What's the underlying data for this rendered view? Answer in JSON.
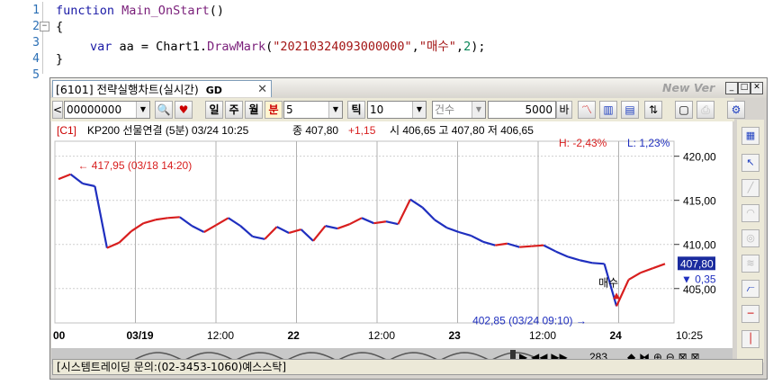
{
  "editor": {
    "line_numbers": [
      "1",
      "2",
      "3",
      "4",
      "5"
    ],
    "lines": {
      "l1_kw": "function",
      "l1_fn": "Main_OnStart",
      "l1_rest": "()",
      "l2": "{",
      "l3_kw": "var",
      "l3_a": " aa = Chart1.",
      "l3_fn": "DrawMark",
      "l3_p1": "(",
      "l3_s1": "\"20210324093000000\"",
      "l3_c": ",",
      "l3_s2": "\"매수\"",
      "l3_c2": ",",
      "l3_n": "2",
      "l3_end": ");",
      "l4": "}"
    }
  },
  "window": {
    "tab_title": "[6101] 전략실행차트(실시간)",
    "tab_link_icon": "link-icon",
    "new_ver": "New Ver",
    "toolbar": {
      "code": "00000000",
      "period_labels": [
        "일",
        "주",
        "월",
        "분"
      ],
      "minute_value": "5",
      "tick_label": "틱",
      "tick_value": "10",
      "count_label": "건수",
      "count_value": "5000",
      "unit": "바"
    },
    "status_text": "[시스템트레이딩 문의:(02-3453-1060)예스스탁]",
    "scroll_count": "283"
  },
  "chart_data": {
    "type": "line",
    "title": "[C1]  KP200 선물연결 (5분) 03/24 10:25   종 407,80 +1,15   시 406,65 고 407,80 저 406,65",
    "header": {
      "code": "[C1]",
      "name": "KP200 선물연결 (5분) 03/24 10:25",
      "close_label": "종 407,80",
      "change": "+1,15",
      "ohlc": "시 406,65 고 407,80 저 406,65"
    },
    "high_label": "H: -2,43%",
    "low_label": "L: 1,23%",
    "yticks": [
      "420,00",
      "415,00",
      "410,00",
      "405,00"
    ],
    "ytick_values": [
      420,
      415,
      410,
      405
    ],
    "ylim": [
      401.1,
      421.7
    ],
    "xticks": [
      "00",
      "03/19",
      "12:00",
      "22",
      "12:00",
      "23",
      "12:00",
      "24",
      "10:25"
    ],
    "xtick_positions": [
      0,
      1,
      2,
      3,
      4,
      5,
      6,
      7,
      8
    ],
    "annotation_max": "417,95 (03/18 14:20)",
    "annotation_min": "402,85 (03/24 09:10)",
    "mark_label": "매수",
    "current_price": "407,80",
    "current_change": "0,35",
    "series": [
      {
        "values": [
          417.4,
          417.95,
          416.9,
          416.6,
          409.6,
          410.2,
          411.5,
          412.4,
          412.8,
          413.0,
          413.1,
          412.1,
          411.4,
          412.2,
          413.0,
          412.1,
          410.9,
          410.6,
          412.0,
          411.3,
          411.7,
          410.4,
          412.1,
          411.8,
          412.3,
          413.0,
          412.4,
          412.6,
          412.3,
          415.1,
          414.2,
          412.8,
          411.9,
          411.4,
          411.0,
          410.3,
          409.9,
          410.1,
          409.7,
          409.8,
          409.9,
          409.2,
          408.6,
          408.2,
          407.9,
          407.8,
          403.0,
          406.0,
          406.8,
          407.3,
          407.8
        ]
      }
    ]
  },
  "colors": {
    "up": "#d81e1e",
    "down": "#1f2fbf",
    "accent_box": "#1a2b9e"
  }
}
